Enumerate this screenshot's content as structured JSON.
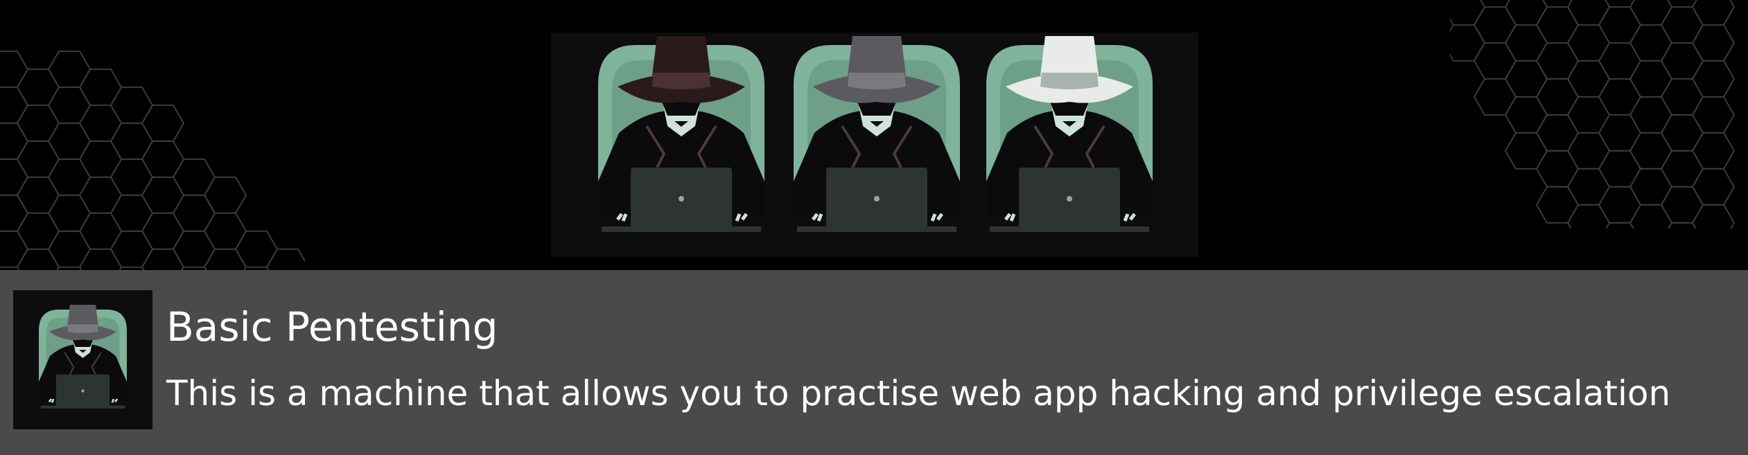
{
  "banner": {
    "image": "three-hat-hackers-banner",
    "hackers": [
      {
        "name": "black-hat-hacker-icon",
        "hat_color": "#2b1a1c",
        "hat_band": "#4a3234"
      },
      {
        "name": "grey-hat-hacker-icon",
        "hat_color": "#5b5b5f",
        "hat_band": "#7a7a7e"
      },
      {
        "name": "white-hat-hacker-icon",
        "hat_color": "#e8ebe9",
        "hat_band": "#a9b3ae"
      }
    ],
    "decoration": "hexagon-pattern"
  },
  "room": {
    "thumbnail": "grey-hat-hacker-icon",
    "title": "Basic Pentesting",
    "description": "This is a machine that allows you to practise web app hacking and privilege escalation"
  },
  "colors": {
    "background": "#000000",
    "info_bar": "#4a4a4a",
    "accent_green": "#7fb39b",
    "text": "#ffffff"
  }
}
